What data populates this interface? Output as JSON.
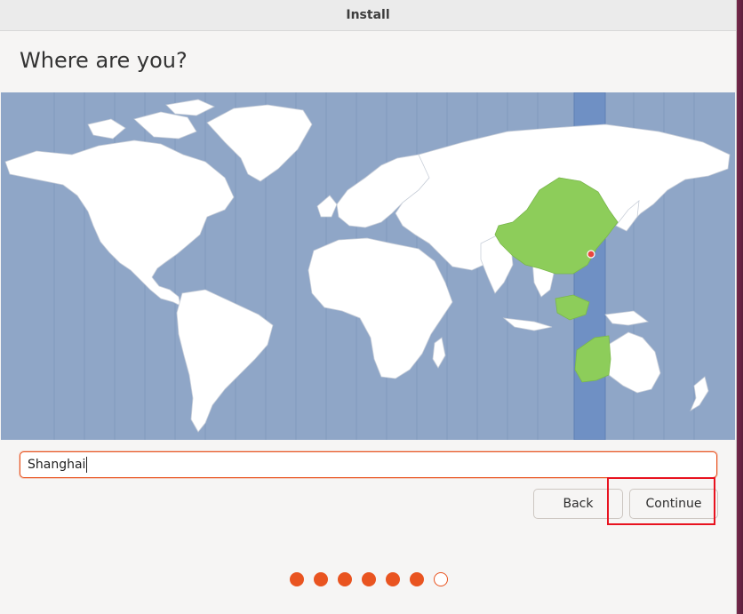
{
  "window": {
    "title": "Install"
  },
  "page": {
    "title": "Where are you?"
  },
  "map": {
    "selected_city": "Shanghai",
    "colors": {
      "ocean": "#8fa6c7",
      "land": "#ffffff",
      "selected_timezone_land": "#8dcd5a",
      "selected_timezone_band": "#6f90c4",
      "marker": "#e9463f"
    }
  },
  "location_field": {
    "value": "Shanghai"
  },
  "buttons": {
    "back": "Back",
    "continue": "Continue"
  },
  "progress": {
    "total_steps": 7,
    "completed_steps": 6
  },
  "colors": {
    "accent": "#e95420",
    "highlight_box": "#e8121f"
  }
}
